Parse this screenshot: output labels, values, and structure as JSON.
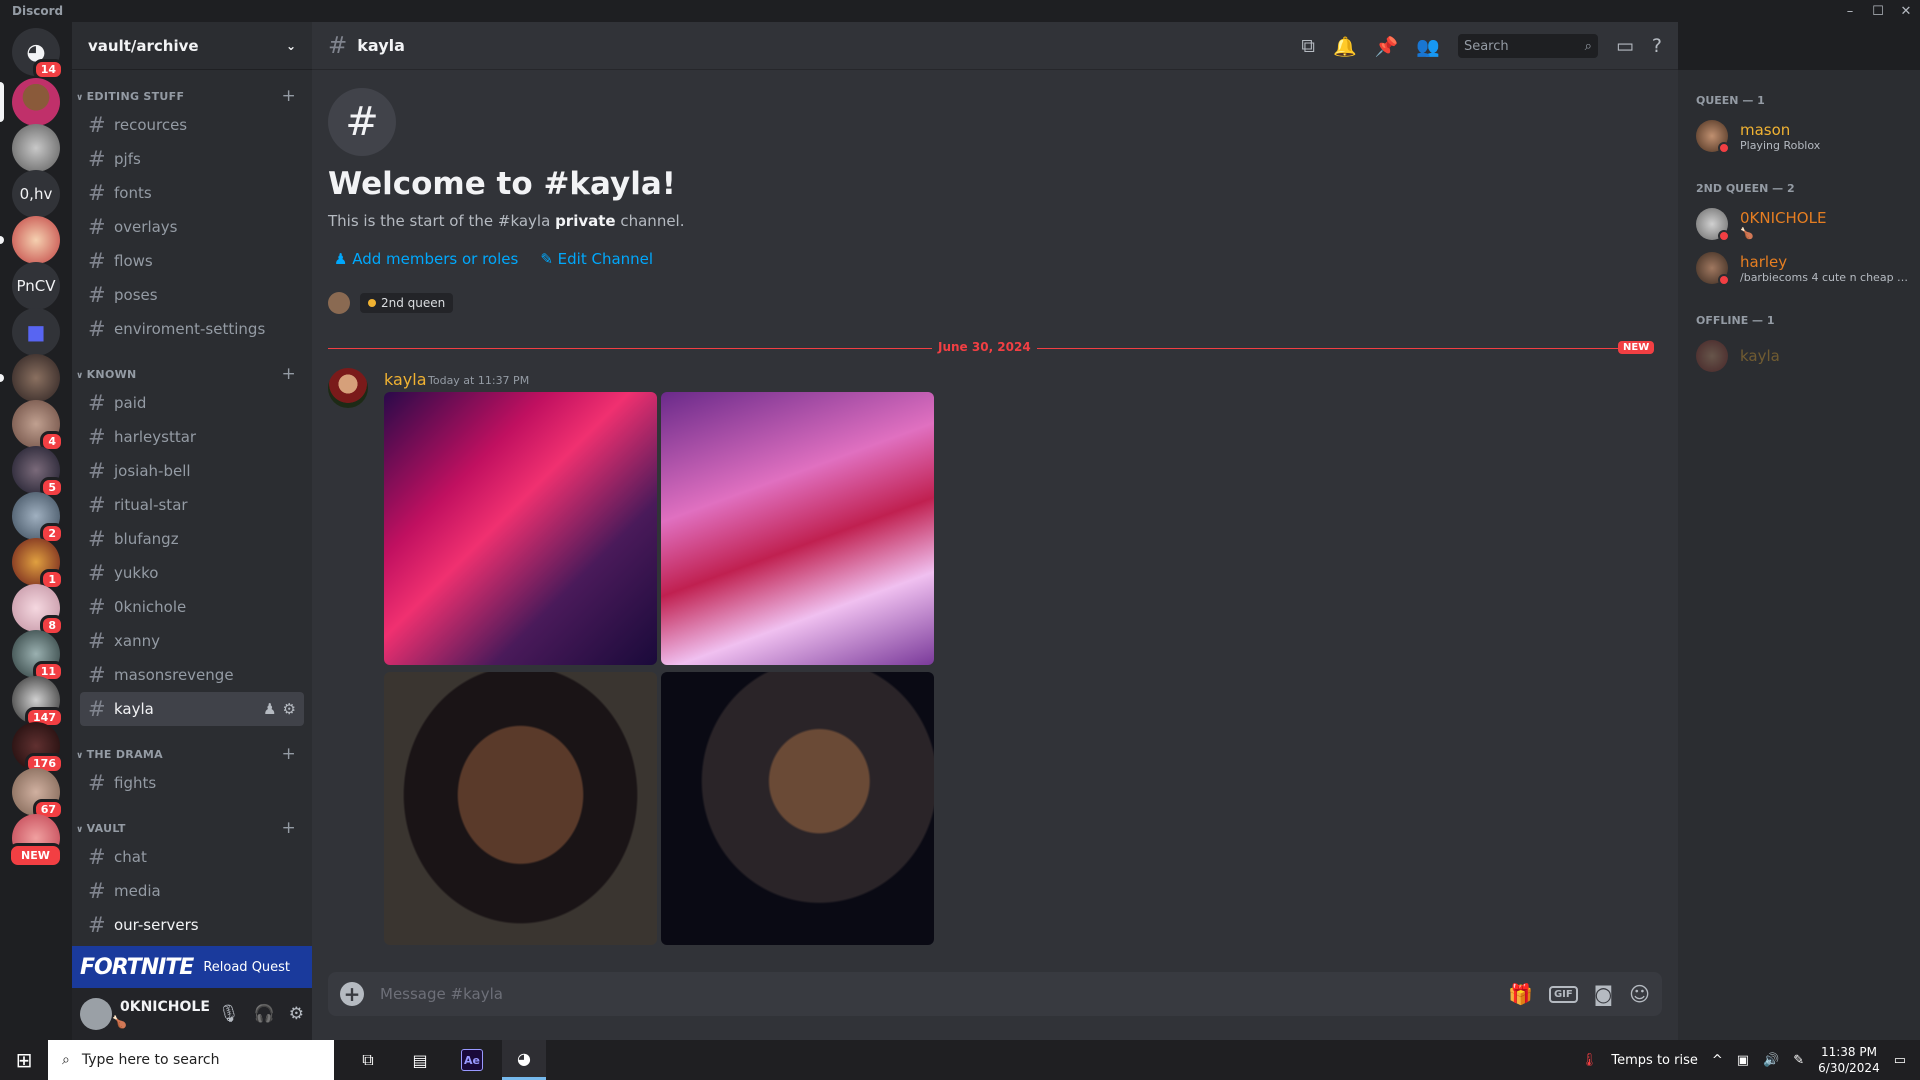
{
  "window": {
    "title": "Discord"
  },
  "servers": [
    {
      "type": "home",
      "badge": "14"
    },
    {
      "badge": ""
    },
    {
      "badge": ""
    },
    {
      "label": "0,hv",
      "badge": ""
    },
    {
      "badge": ""
    },
    {
      "label": "PnCV",
      "badge": ""
    },
    {
      "type": "folder",
      "badge": ""
    },
    {
      "badge": ""
    },
    {
      "badge": "4"
    },
    {
      "badge": "5"
    },
    {
      "badge": "2"
    },
    {
      "badge": "1"
    },
    {
      "badge": "8"
    },
    {
      "badge": "11"
    },
    {
      "badge": "147"
    },
    {
      "badge": "176"
    },
    {
      "badge": "67"
    },
    {
      "badge": "NEW"
    }
  ],
  "guild": {
    "name": "vault/archive"
  },
  "categories": [
    {
      "name": "EDITING STUFF",
      "channels": [
        "recources",
        "pjfs",
        "fonts",
        "overlays",
        "flows",
        "poses",
        "enviroment-settings"
      ]
    },
    {
      "name": "KNOWN",
      "channels": [
        "paid",
        "harleysttar",
        "josiah-bell",
        "ritual-star",
        "blufangz",
        "yukko",
        "0knichole",
        "xanny",
        "masonsrevenge",
        "kayla"
      ]
    },
    {
      "name": "THE DRAMA",
      "channels": [
        "fights"
      ]
    },
    {
      "name": "VAULT",
      "channels": [
        "chat",
        "media",
        "our-servers"
      ]
    }
  ],
  "quest": {
    "game": "FORTNITE",
    "label": "Reload Quest"
  },
  "user": {
    "name": "0KNICHOLE",
    "status": "🍗"
  },
  "channel": {
    "name": "kayla"
  },
  "header": {
    "search_placeholder": "Search"
  },
  "welcome": {
    "title": "Welcome to #kayla!",
    "sub_pre": "This is the start of the #kayla ",
    "sub_bold": "private",
    "sub_post": " channel.",
    "add_members": "Add members or roles",
    "edit_channel": "Edit Channel",
    "role": "2nd queen"
  },
  "divider": {
    "date": "June 30, 2024",
    "new_label": "NEW"
  },
  "message": {
    "author": "kayla",
    "timestamp": "Today at 11:37 PM",
    "image_count": 4
  },
  "composer": {
    "placeholder": "Message #kayla"
  },
  "members": {
    "groups": [
      {
        "title": "QUEEN — 1",
        "members": [
          {
            "name": "mason",
            "activity": "Playing Roblox",
            "color": "#f0b232"
          }
        ]
      },
      {
        "title": "2ND QUEEN — 2",
        "members": [
          {
            "name": "0KNICHOLE",
            "activity": "🍗",
            "color": "#e67e22"
          },
          {
            "name": "harley",
            "activity": "/barbiecoms 4 cute n cheap e...",
            "color": "#e67e22"
          }
        ]
      },
      {
        "title": "OFFLINE — 1",
        "members": [
          {
            "name": "kayla",
            "activity": "",
            "color": "#f0b232"
          }
        ]
      }
    ]
  },
  "taskbar": {
    "search_placeholder": "Type here to search",
    "weather": "Temps to rise",
    "time": "11:38 PM",
    "date": "6/30/2024"
  },
  "colors": {
    "accent": "#5865f2",
    "link": "#00a8fc",
    "danger": "#f23f43",
    "gold": "#f0b232"
  }
}
